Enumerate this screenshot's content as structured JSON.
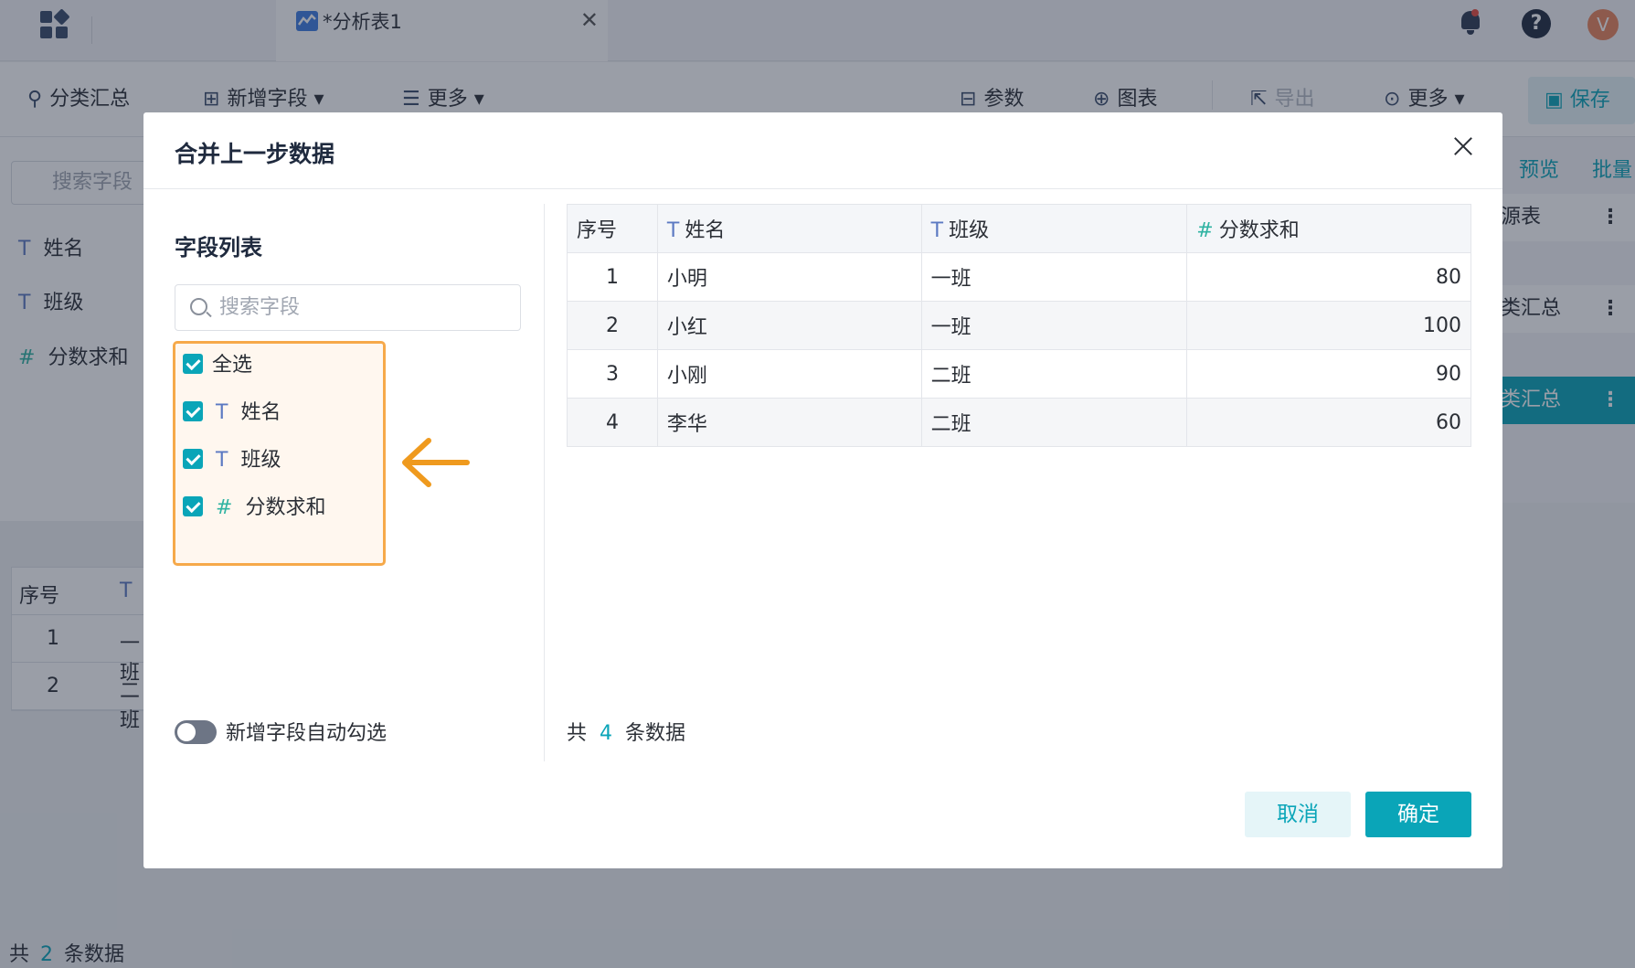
{
  "app": {
    "doc_tab_title": "*分析表1",
    "avatar_letter": "V",
    "help_glyph": "?"
  },
  "toolbar": {
    "group_summary": "分类汇总",
    "add_field": "新增字段",
    "more_left": "更多",
    "params": "参数",
    "chart": "图表",
    "export": "导出",
    "more_right": "更多",
    "save": "保存"
  },
  "left_panel": {
    "search_placeholder": "搜索字段",
    "fields": [
      "姓名",
      "班级",
      "分数求和"
    ]
  },
  "right_panel": {
    "preview": "预览",
    "batch": "批量",
    "items": [
      "源表",
      "类汇总",
      "类汇总"
    ]
  },
  "bottom_table": {
    "header": "序号",
    "rows": [
      [
        "1",
        "一班"
      ],
      [
        "2",
        "二班"
      ]
    ]
  },
  "bottom_count": {
    "prefix": "共",
    "count": "2",
    "suffix": "条数据"
  },
  "dialog": {
    "title": "合并上一步数据",
    "field_list_title": "字段列表",
    "search_placeholder": "搜索字段",
    "select_all": "全选",
    "fields": [
      {
        "type": "T",
        "name": "姓名"
      },
      {
        "type": "T",
        "name": "班级"
      },
      {
        "type": "#",
        "name": "分数求和"
      }
    ],
    "auto_check_label": "新增字段自动勾选",
    "table": {
      "headers": [
        "序号",
        "姓名",
        "班级",
        "分数求和"
      ],
      "rows": [
        [
          "1",
          "小明",
          "一班",
          "80"
        ],
        [
          "2",
          "小红",
          "一班",
          "100"
        ],
        [
          "3",
          "小刚",
          "二班",
          "90"
        ],
        [
          "4",
          "李华",
          "二班",
          "60"
        ]
      ]
    },
    "count": {
      "prefix": "共",
      "count": "4",
      "suffix": "条数据"
    },
    "cancel": "取消",
    "confirm": "确定"
  },
  "colors": {
    "accent": "#0aa5b8",
    "highlight": "#f6a94a"
  }
}
